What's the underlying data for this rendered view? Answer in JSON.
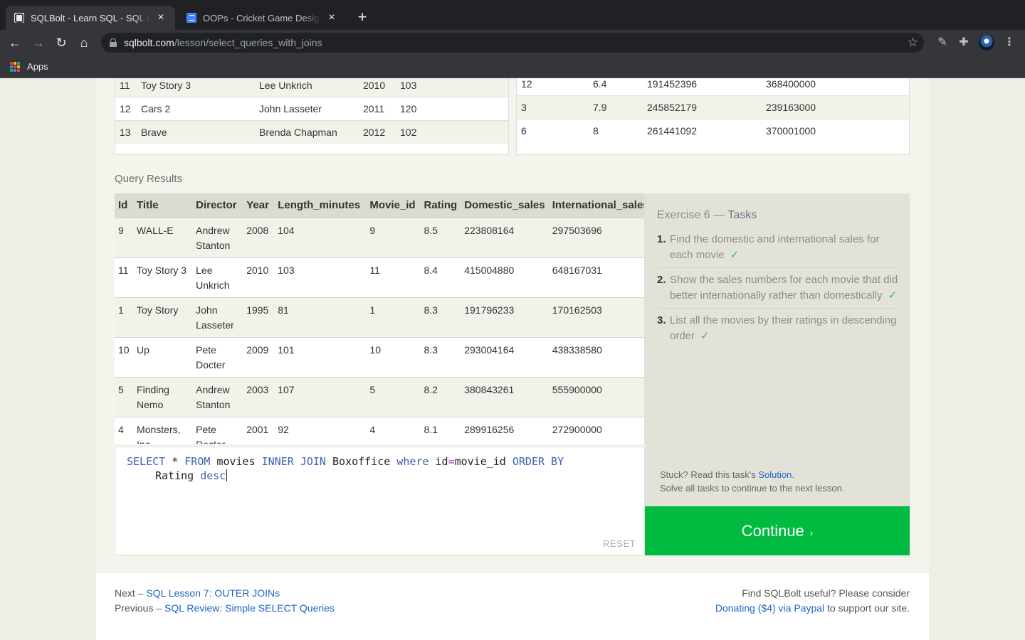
{
  "browser": {
    "tabs": [
      {
        "title": "SQLBolt - Learn SQL - SQL Lesson",
        "active": true
      },
      {
        "title": "OOPs - Cricket Game Design - Goo",
        "active": false
      }
    ],
    "url_host": "sqlbolt.com",
    "url_path": "/lesson/select_queries_with_joins",
    "bookmarks": {
      "apps_label": "Apps"
    }
  },
  "movies_preview": {
    "rows": [
      [
        "11",
        "Toy Story 3",
        "Lee Unkrich",
        "2010",
        "103"
      ],
      [
        "12",
        "Cars 2",
        "John Lasseter",
        "2011",
        "120"
      ],
      [
        "13",
        "Brave",
        "Brenda Chapman",
        "2012",
        "102"
      ]
    ]
  },
  "boxoffice_preview": {
    "rows": [
      [
        "12",
        "6.4",
        "191452396",
        "368400000"
      ],
      [
        "3",
        "7.9",
        "245852179",
        "239163000"
      ],
      [
        "6",
        "8",
        "261441092",
        "370001000"
      ]
    ]
  },
  "query_results": {
    "label": "Query Results",
    "columns": [
      "Id",
      "Title",
      "Director",
      "Year",
      "Length_minutes",
      "Movie_id",
      "Rating",
      "Domestic_sales",
      "International_sales"
    ],
    "rows": [
      [
        "9",
        "WALL-E",
        "Andrew Stanton",
        "2008",
        "104",
        "9",
        "8.5",
        "223808164",
        "297503696"
      ],
      [
        "11",
        "Toy Story 3",
        "Lee Unkrich",
        "2010",
        "103",
        "11",
        "8.4",
        "415004880",
        "648167031"
      ],
      [
        "1",
        "Toy Story",
        "John Lasseter",
        "1995",
        "81",
        "1",
        "8.3",
        "191796233",
        "170162503"
      ],
      [
        "10",
        "Up",
        "Pete Docter",
        "2009",
        "101",
        "10",
        "8.3",
        "293004164",
        "438338580"
      ],
      [
        "5",
        "Finding Nemo",
        "Andrew Stanton",
        "2003",
        "107",
        "5",
        "8.2",
        "380843261",
        "555900000"
      ],
      [
        "4",
        "Monsters, Inc.",
        "Pete Docter",
        "2001",
        "92",
        "4",
        "8.1",
        "289916256",
        "272900000"
      ]
    ]
  },
  "editor": {
    "query": "SELECT * FROM movies INNER JOIN Boxoffice where id=movie_id ORDER BY Rating desc",
    "reset_label": "RESET"
  },
  "tasks": {
    "exercise": "Exercise 6",
    "separator": " — ",
    "heading": "Tasks",
    "items": [
      {
        "num": "1.",
        "text": "Find the domestic and international sales for each movie",
        "check": "✓"
      },
      {
        "num": "2.",
        "text": "Show the sales numbers for each movie that did better internationally rather than domestically",
        "check": "✓"
      },
      {
        "num": "3.",
        "text": "List all the movies by their ratings in descending order",
        "check": "✓"
      }
    ],
    "stuck_prefix": "Stuck? Read this task's ",
    "solution_link": "Solution",
    "stuck_suffix": ".",
    "solve_all": "Solve all tasks to continue to the next lesson.",
    "continue_label": "Continue",
    "continue_arrow": "›"
  },
  "footer": {
    "next_prefix": "Next – ",
    "next_link": "SQL Lesson 7: OUTER JOINs",
    "prev_prefix": "Previous – ",
    "prev_link": "SQL Review: Simple SELECT Queries",
    "donate_line1": "Find SQLBolt useful? Please consider",
    "donate_link": "Donating ($4) via Paypal",
    "donate_suffix": " to support our site."
  },
  "colors": {
    "continue": "#00bb40",
    "link": "#1e64c8",
    "check": "#34c04a",
    "keyword": "#3d5fb0"
  }
}
